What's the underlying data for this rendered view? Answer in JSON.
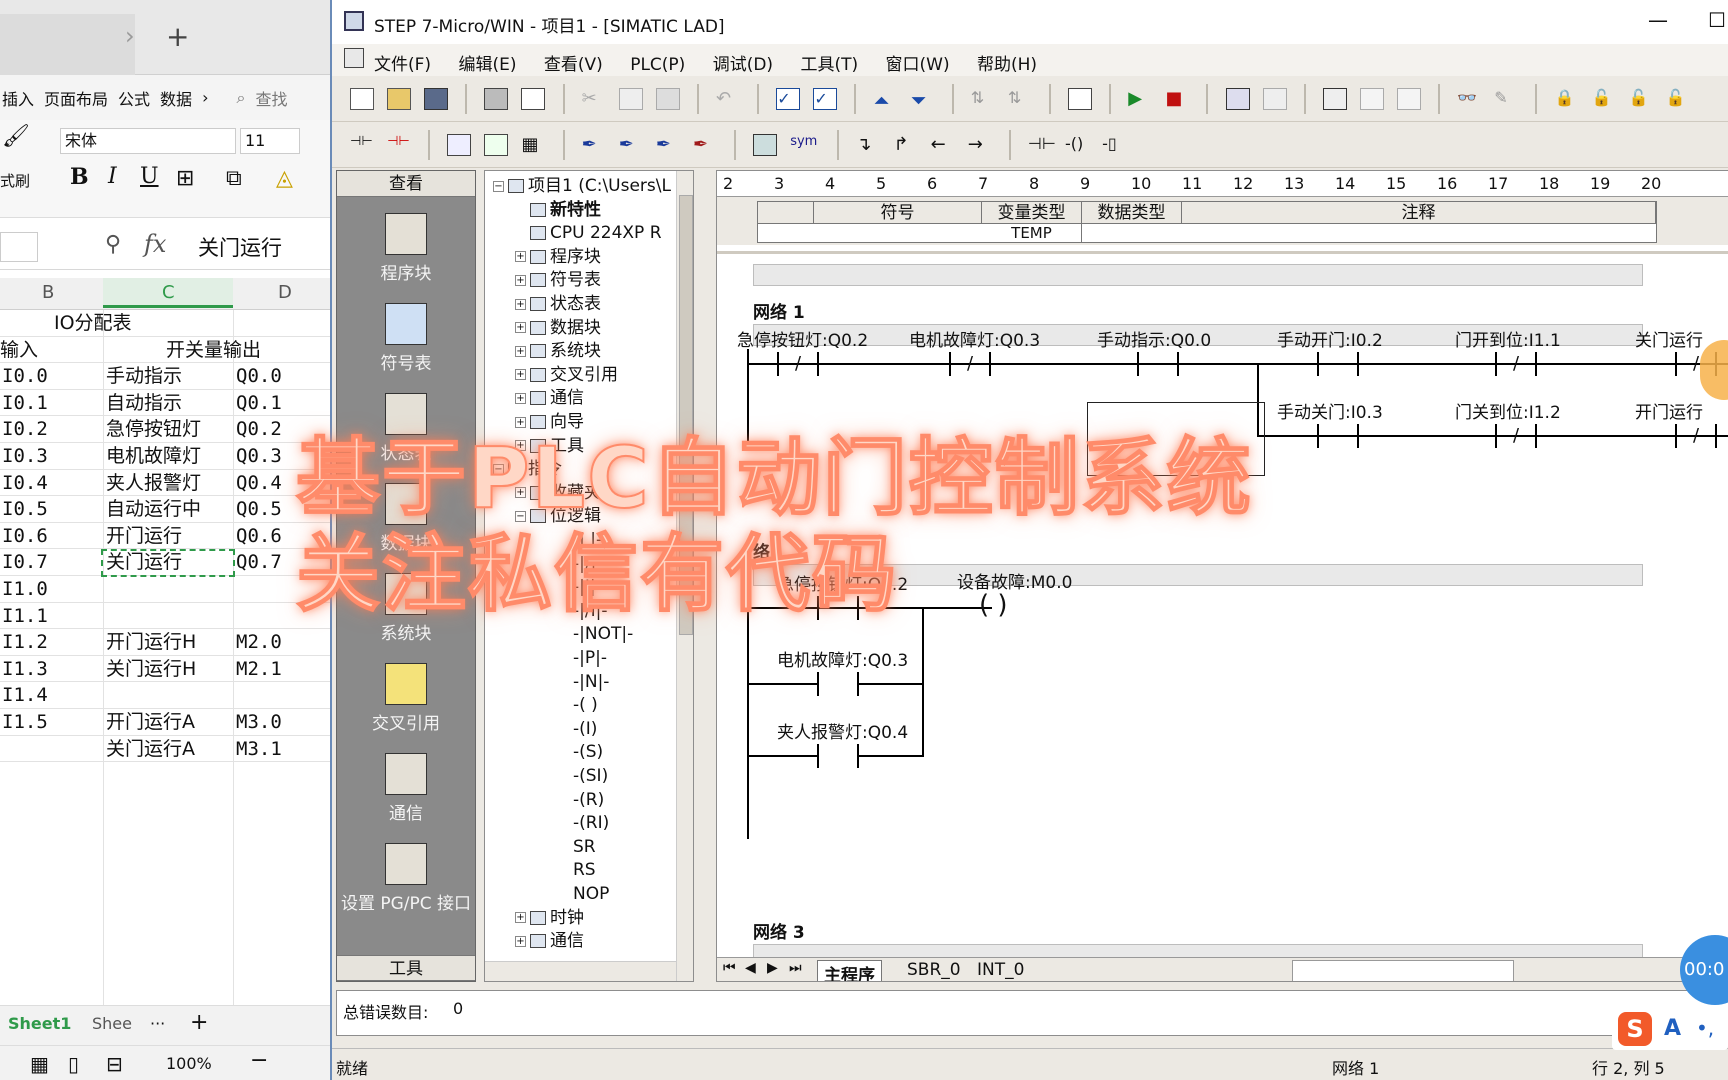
{
  "spreadsheet": {
    "ribbon_menu": [
      "插入",
      "页面布局",
      "公式",
      "数据"
    ],
    "menu_more": "›",
    "search_label": "查找",
    "format_painter": "式刷",
    "font_name": "宋体",
    "font_size": "11",
    "fx": "fx",
    "formula_value": "关门运行",
    "col_headers": [
      "B",
      "C",
      "D"
    ],
    "title": "IO分配表",
    "header_input": "输入",
    "header_output": "开关量输出",
    "rows": [
      {
        "in": "I0.0",
        "name": "手动指示",
        "out": "Q0.0"
      },
      {
        "in": "I0.1",
        "name": "自动指示",
        "out": "Q0.1"
      },
      {
        "in": "I0.2",
        "name": "急停按钮灯",
        "out": "Q0.2"
      },
      {
        "in": "I0.3",
        "name": "电机故障灯",
        "out": "Q0.3"
      },
      {
        "in": "I0.4",
        "name": "夹人报警灯",
        "out": "Q0.4"
      },
      {
        "in": "I0.5",
        "name": "自动运行中",
        "out": "Q0.5"
      },
      {
        "in": "I0.6",
        "name": "开门运行",
        "out": "Q0.6"
      },
      {
        "in": "I0.7",
        "name": "关门运行",
        "out": "Q0.7"
      },
      {
        "in": "I1.0",
        "name": "",
        "out": ""
      },
      {
        "in": "I1.1",
        "name": "",
        "out": ""
      },
      {
        "in": "I1.2",
        "name": "开门运行H",
        "out": "M2.0"
      },
      {
        "in": "I1.3",
        "name": "关门运行H",
        "out": "M2.1"
      },
      {
        "in": "I1.4",
        "name": "",
        "out": ""
      },
      {
        "in": "I1.5",
        "name": "开门运行A",
        "out": "M3.0"
      },
      {
        "in": "",
        "name": "关门运行A",
        "out": "M3.1"
      }
    ],
    "sheet_tab": "Sheet1",
    "sheet_tab2": "Shee",
    "more_dots": "···",
    "add_sheet": "+",
    "zoom": "100%",
    "tab_add": "+",
    "tab_more": "›"
  },
  "app": {
    "title": "STEP 7-Micro/WIN - 项目1 - [SIMATIC LAD]",
    "menus": [
      "文件(F)",
      "编辑(E)",
      "查看(V)",
      "PLC(P)",
      "调试(D)",
      "工具(T)",
      "窗口(W)",
      "帮助(H)"
    ],
    "toolbar_sym": "sym"
  },
  "nav": {
    "header": "查看",
    "items": [
      "程序块",
      "符号表",
      "状态表",
      "数据块",
      "系统块",
      "交叉引用",
      "通信",
      "设置 PG/PC 接口"
    ],
    "footer": "工具"
  },
  "tree": {
    "items": [
      {
        "label": "项目1 (C:\\Users\\L",
        "depth": 0,
        "toggle": "−",
        "bold": false
      },
      {
        "label": "新特性",
        "depth": 1,
        "toggle": "",
        "bold": true
      },
      {
        "label": "CPU 224XP R",
        "depth": 1,
        "toggle": "",
        "bold": false
      },
      {
        "label": "程序块",
        "depth": 1,
        "toggle": "+",
        "bold": false
      },
      {
        "label": "符号表",
        "depth": 1,
        "toggle": "+",
        "bold": false
      },
      {
        "label": "状态表",
        "depth": 1,
        "toggle": "+",
        "bold": false
      },
      {
        "label": "数据块",
        "depth": 1,
        "toggle": "+",
        "bold": false
      },
      {
        "label": "系统块",
        "depth": 1,
        "toggle": "+",
        "bold": false
      },
      {
        "label": "交叉引用",
        "depth": 1,
        "toggle": "+",
        "bold": false
      },
      {
        "label": "通信",
        "depth": 1,
        "toggle": "+",
        "bold": false
      },
      {
        "label": "向导",
        "depth": 1,
        "toggle": "+",
        "bold": false
      },
      {
        "label": "工具",
        "depth": 1,
        "toggle": "+",
        "bold": false
      },
      {
        "label": "指令",
        "depth": 0,
        "toggle": "−",
        "bold": false
      },
      {
        "label": "收藏夹",
        "depth": 1,
        "toggle": "+",
        "bold": false
      },
      {
        "label": "位逻辑",
        "depth": 1,
        "toggle": "−",
        "bold": false
      },
      {
        "label": "-| |-",
        "depth": 2,
        "toggle": "",
        "bold": false
      },
      {
        "label": "-|/|-",
        "depth": 2,
        "toggle": "",
        "bold": false
      },
      {
        "label": "-|I|-",
        "depth": 2,
        "toggle": "",
        "bold": false
      },
      {
        "label": "-|/I|-",
        "depth": 2,
        "toggle": "",
        "bold": false
      },
      {
        "label": "-|NOT|-",
        "depth": 2,
        "toggle": "",
        "bold": false
      },
      {
        "label": "-|P|-",
        "depth": 2,
        "toggle": "",
        "bold": false
      },
      {
        "label": "-|N|-",
        "depth": 2,
        "toggle": "",
        "bold": false
      },
      {
        "label": "-( )",
        "depth": 2,
        "toggle": "",
        "bold": false
      },
      {
        "label": "-(I)",
        "depth": 2,
        "toggle": "",
        "bold": false
      },
      {
        "label": "-(S)",
        "depth": 2,
        "toggle": "",
        "bold": false
      },
      {
        "label": "-(SI)",
        "depth": 2,
        "toggle": "",
        "bold": false
      },
      {
        "label": "-(R)",
        "depth": 2,
        "toggle": "",
        "bold": false
      },
      {
        "label": "-(RI)",
        "depth": 2,
        "toggle": "",
        "bold": false
      },
      {
        "label": "SR",
        "depth": 2,
        "toggle": "",
        "bold": false
      },
      {
        "label": "RS",
        "depth": 2,
        "toggle": "",
        "bold": false
      },
      {
        "label": "NOP",
        "depth": 2,
        "toggle": "",
        "bold": false
      },
      {
        "label": "时钟",
        "depth": 1,
        "toggle": "+",
        "bold": false
      },
      {
        "label": "通信",
        "depth": 1,
        "toggle": "+",
        "bold": false
      }
    ]
  },
  "editor": {
    "ruler": [
      "2",
      "3",
      "4",
      "5",
      "6",
      "7",
      "8",
      "9",
      "10",
      "11",
      "12",
      "13",
      "14",
      "15",
      "16",
      "17",
      "18",
      "19",
      "20"
    ],
    "var_headers": [
      "符号",
      "变量类型",
      "数据类型",
      "注释"
    ],
    "var_row": "TEMP",
    "network1": "网络 1",
    "network2_partial": "络",
    "network3": "网络 3",
    "n1_row1": [
      "急停按钮灯:Q0.2",
      "电机故障灯:Q0.3",
      "手动指示:Q0.0",
      "手动开门:I0.2",
      "门开到位:I1.1",
      "关门运行"
    ],
    "n1_row2": [
      "手动关门:I0.3",
      "门关到位:I1.2",
      "开门运行"
    ],
    "n2_contacts": [
      "急停按钮灯:Q0.2",
      "电机故障灯:Q0.3",
      "夹人报警灯:Q0.4"
    ],
    "n2_coil": "设备故障:M0.0",
    "tabs": [
      "主程序",
      "SBR_0",
      "INT_0"
    ]
  },
  "errors": {
    "label": "总错误数目:",
    "count": "0"
  },
  "status": {
    "ready": "就绪",
    "network": "网络 1",
    "position": "行 2, 列 5"
  },
  "overlay": {
    "line1": "基于PLC自动门控制系统",
    "line2": "关注私信有代码"
  },
  "badge": "00:0",
  "ime": "A"
}
